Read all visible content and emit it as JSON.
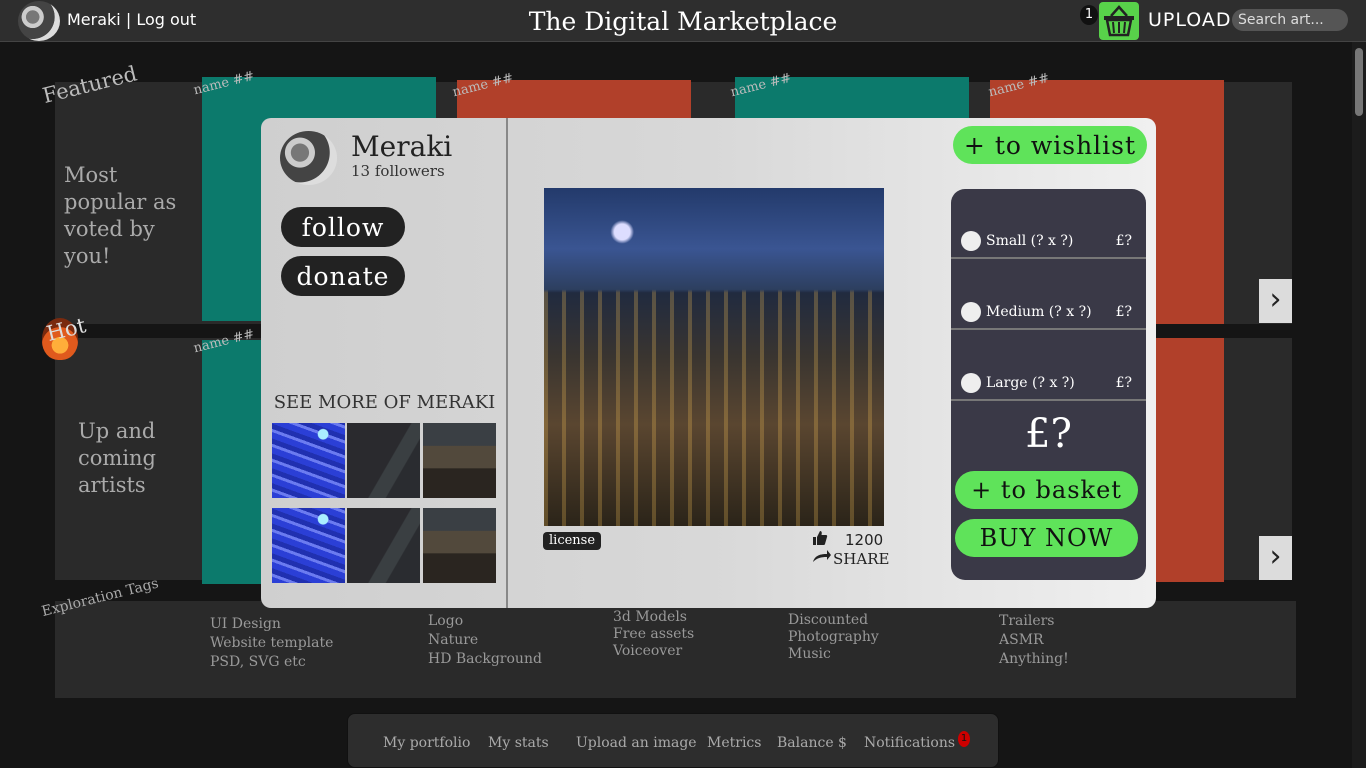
{
  "topbar": {
    "user_name": "Meraki",
    "separator": " | ",
    "logout_label": "Log out",
    "site_title": "The Digital Marketplace",
    "basket_count": "1",
    "upload_label": "UPLOAD",
    "search_placeholder": "Search art..."
  },
  "sections": {
    "featured_label": "Featured",
    "featured_desc": "Most popular as voted by you!",
    "hot_label": "Hot",
    "hot_desc": "Up and coming artists",
    "card_name": "name ##",
    "next_glyph": "›"
  },
  "tags": {
    "title": "Exploration Tags",
    "col1": [
      "UI Design",
      "Website template",
      "PSD, SVG etc"
    ],
    "col2": [
      "Logo",
      "Nature",
      "HD Background"
    ],
    "col3": [
      "3d Models",
      "Free assets",
      "Voiceover"
    ],
    "col4": [
      "Discounted",
      "Photography",
      "Music"
    ],
    "col5": [
      "Trailers",
      "ASMR",
      "Anything!"
    ]
  },
  "bottom_nav": {
    "items": [
      "My portfolio",
      "My stats",
      "Upload an image",
      "Metrics",
      "Balance $",
      "Notifications"
    ],
    "notification_count": "1"
  },
  "modal": {
    "artist_name": "Meraki",
    "followers": "13 followers",
    "follow_label": "follow",
    "donate_label": "donate",
    "see_more": "SEE MORE OF MERAKI",
    "license_label": "license",
    "likes": "1200",
    "share_label": "SHARE",
    "wishlist_label": "+ to wishlist",
    "sizes": [
      {
        "label": "Small (? x ?)",
        "price": "£?"
      },
      {
        "label": "Medium (? x ?)",
        "price": "£?"
      },
      {
        "label": "Large (? x ?)",
        "price": "£?"
      }
    ],
    "total_price": "£?",
    "basket_label": "+ to basket",
    "buynow_label": "BUY NOW"
  },
  "colors": {
    "accent_green": "#5fe35a",
    "card_teal": "#0c7a6c",
    "card_red": "#b1402a",
    "price_panel": "#3a3947"
  },
  "icons": [
    "basket-icon",
    "search-icon",
    "chevron-right-icon",
    "thumbs-up-icon",
    "share-arrow-icon",
    "fire-icon"
  ]
}
